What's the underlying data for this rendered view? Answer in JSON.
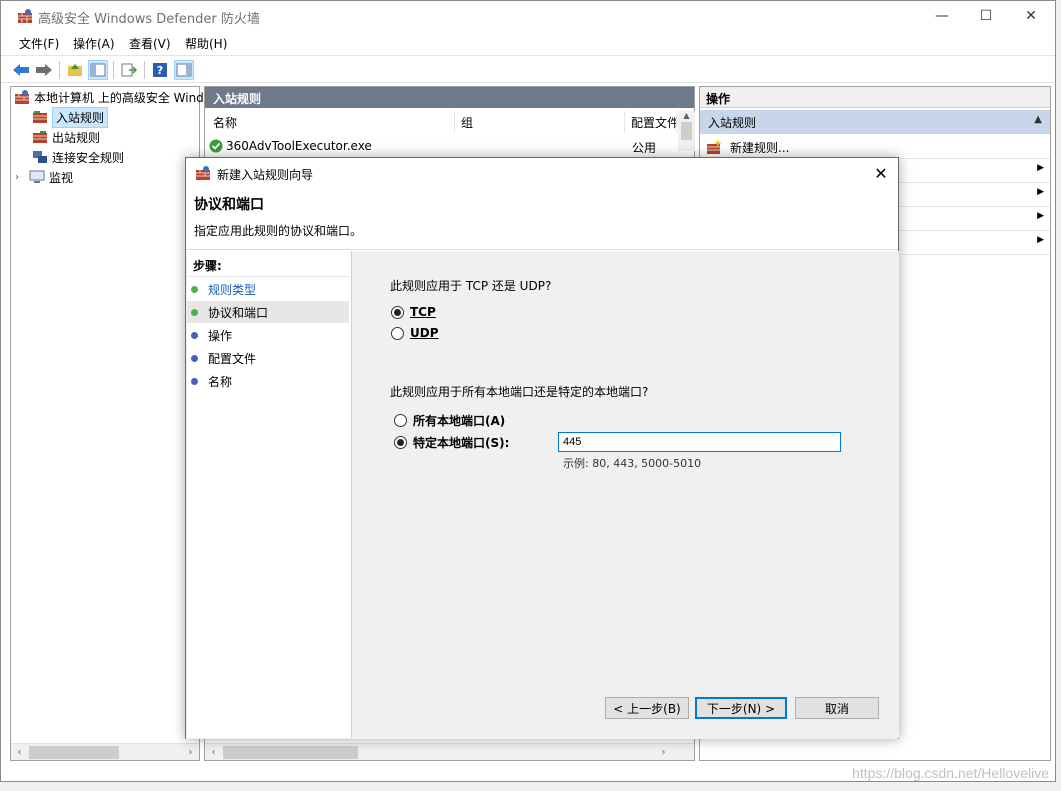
{
  "window": {
    "title": "高级安全 Windows Defender 防火墙",
    "minimize": "—",
    "maximize": "☐",
    "close": "✕"
  },
  "menu": [
    "文件(F)",
    "操作(A)",
    "查看(V)",
    "帮助(H)"
  ],
  "tree": {
    "root": "本地计算机 上的高级安全 Wind",
    "items": [
      {
        "label": "入站规则",
        "selected": true
      },
      {
        "label": "出站规则",
        "selected": false
      },
      {
        "label": "连接安全规则",
        "selected": false
      },
      {
        "label": "监视",
        "selected": false
      }
    ]
  },
  "middle": {
    "header": "入站规则",
    "columns": [
      "名称",
      "组",
      "配置文件"
    ],
    "rows": [
      {
        "name": "360AdvToolExecutor.exe",
        "group": "",
        "profile": "公用"
      }
    ]
  },
  "actions": {
    "header": "操作",
    "section": "入站规则",
    "items": [
      "新建规则..."
    ]
  },
  "dialog": {
    "title": "新建入站规则向导",
    "heading": "协议和端口",
    "subtitle": "指定应用此规则的协议和端口。",
    "steps_title": "步骤:",
    "steps": [
      {
        "label": "规则类型",
        "color": "#4cae4c",
        "link": true
      },
      {
        "label": "协议和端口",
        "color": "#4cae4c",
        "current": true
      },
      {
        "label": "操作",
        "color": "#4a5ebd"
      },
      {
        "label": "配置文件",
        "color": "#4a5ebd"
      },
      {
        "label": "名称",
        "color": "#4a5ebd"
      }
    ],
    "q1": "此规则应用于 TCP 还是 UDP?",
    "protocols": [
      {
        "label": "TCP",
        "selected": true
      },
      {
        "label": "UDP",
        "selected": false
      }
    ],
    "q2": "此规则应用于所有本地端口还是特定的本地端口?",
    "port_options": [
      {
        "label": "所有本地端口(A)",
        "selected": false
      },
      {
        "label": "特定本地端口(S):",
        "selected": true
      }
    ],
    "port_value": "445",
    "example": "示例: 80, 443, 5000-5010",
    "buttons": {
      "back": "< 上一步(B)",
      "next": "下一步(N) >",
      "cancel": "取消"
    }
  },
  "watermark": "https://blog.csdn.net/Hellovelive"
}
